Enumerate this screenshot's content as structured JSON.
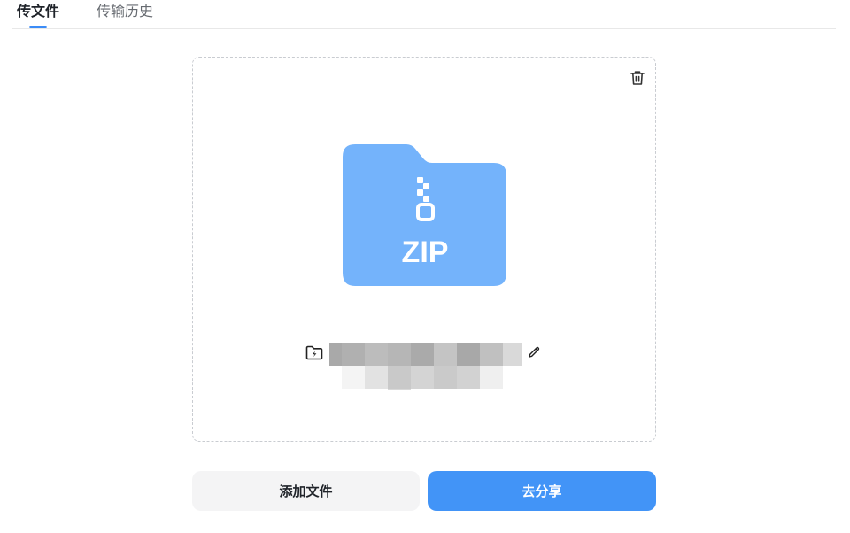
{
  "tabs": {
    "upload": "传文件",
    "history": "传输历史"
  },
  "file_card": {
    "file_type_label": "ZIP",
    "file_name": ""
  },
  "actions": {
    "add_file": "添加文件",
    "share": "去分享"
  },
  "icons": {
    "trash": "trash-icon",
    "folder": "folder-icon",
    "edit": "pencil-icon",
    "zip": "zip-folder-icon"
  },
  "colors": {
    "accent": "#3b8cf7",
    "share_button": "#4294f7",
    "zip_folder": "#74b3fb",
    "add_button": "#f4f4f5"
  }
}
